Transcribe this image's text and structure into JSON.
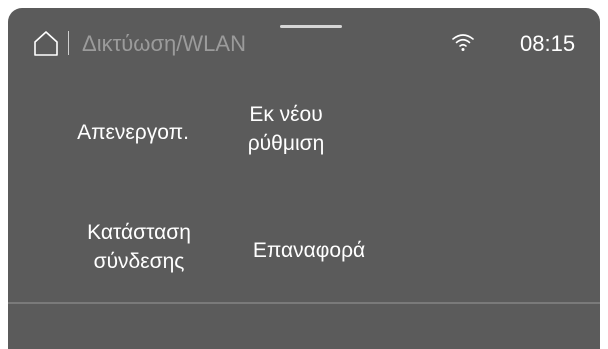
{
  "header": {
    "title": "Δικτύωση/WLAN",
    "clock": "08:15",
    "home_icon": "home-icon",
    "wifi_icon": "wifi-icon"
  },
  "menu": {
    "deactivate": "Απενεργοπ.",
    "resetup_line1": "Εκ νέου",
    "resetup_line2": "ρύθμιση",
    "status_line1": "Κατάσταση",
    "status_line2": "σύνδεσης",
    "reset": "Επαναφορά"
  },
  "colors": {
    "screen_background": "#5b5b5b",
    "text": "#ffffff",
    "title_text": "#9b9b9b"
  }
}
